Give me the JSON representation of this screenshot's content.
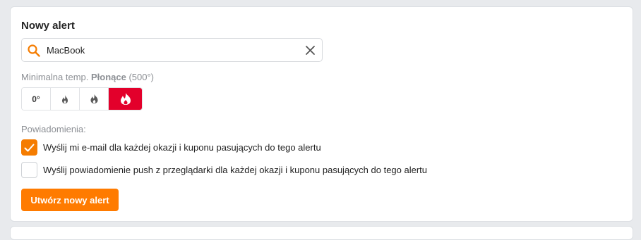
{
  "form": {
    "title": "Nowy alert",
    "search": {
      "value": "MacBook",
      "icon": "search-icon"
    },
    "temperature": {
      "label_prefix": "Minimalna temp. ",
      "label_selected": "Płonące",
      "label_suffix": " (500°)",
      "options": [
        {
          "label": "0°",
          "icon": ""
        },
        {
          "label": "",
          "icon": "flame-small-icon"
        },
        {
          "label": "",
          "icon": "flame-medium-icon"
        },
        {
          "label": "",
          "icon": "flame-large-icon",
          "active": true
        }
      ]
    },
    "notifications": {
      "label": "Powiadomienia:",
      "email": {
        "text": "Wyślij mi e-mail dla każdej okazji i kuponu pasujących do tego alertu",
        "checked": true
      },
      "push": {
        "text": "Wyślij powiadomienie push z przeglądarki dla każdej okazji i kuponu pasujących do tego alertu",
        "checked": false
      }
    },
    "submit_label": "Utwórz nowy alert"
  },
  "colors": {
    "accent": "#ff7b00",
    "active_temp": "#e3002b",
    "checkbox_checked": "#f57c00"
  }
}
